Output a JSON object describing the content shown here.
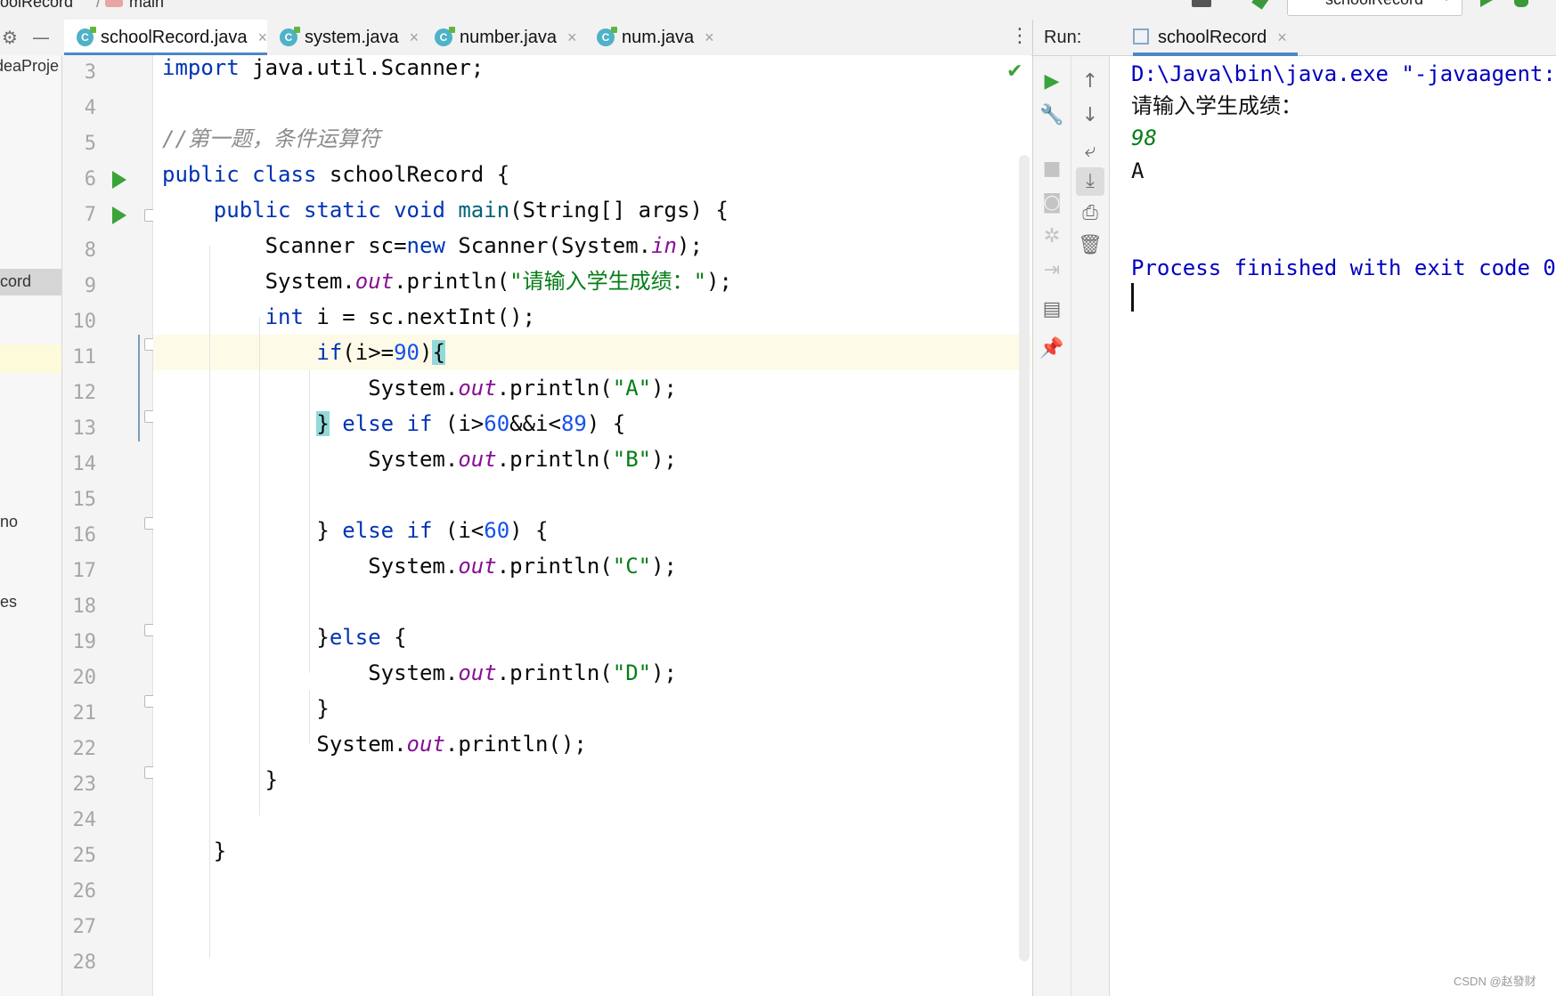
{
  "breadcrumb": {
    "file": "oolRecord",
    "separator": "/",
    "branch": "main"
  },
  "toolbar": {
    "run_config": "schoolRecord"
  },
  "editor_tabs": [
    {
      "label": "schoolRecord.java",
      "active": true
    },
    {
      "label": "system.java",
      "active": false
    },
    {
      "label": "number.java",
      "active": false
    },
    {
      "label": "num.java",
      "active": false
    }
  ],
  "project_panel": {
    "items": [
      "deaProje",
      "cord",
      "no",
      "es"
    ]
  },
  "code": {
    "line_numbers": [
      "3",
      "4",
      "5",
      "6",
      "7",
      "8",
      "9",
      "10",
      "11",
      "12",
      "13",
      "14",
      "15",
      "16",
      "17",
      "18",
      "19",
      "20",
      "21",
      "22",
      "23",
      "24",
      "25",
      "26",
      "27",
      "28"
    ],
    "l3": {
      "kw": "import",
      "rest": " java.util.Scanner;"
    },
    "l5": {
      "comment": "//第一题，条件运算符"
    },
    "l6": {
      "kw1": "public",
      "kw2": "class",
      "rest": " schoolRecord {"
    },
    "l7": {
      "kw1": "public",
      "kw2": "static",
      "kw3": "void",
      "fn": "main",
      "rest": "(String[] args) {"
    },
    "l8": {
      "a": "Scanner sc=",
      "kw": "new",
      "b": " Scanner(System.",
      "fld": "in",
      "c": ");"
    },
    "l9": {
      "a": "System.",
      "fld": "out",
      "b": ".println(",
      "str": "\"请输入学生成绩：\"",
      "c": ");"
    },
    "l10": {
      "kw": "int",
      "rest": " i = sc.nextInt();"
    },
    "l11": {
      "kw": "if",
      "a": "(i>=",
      "num": "90",
      "b": ")",
      "brace": "{"
    },
    "l12": {
      "a": "System.",
      "fld": "out",
      "b": ".println(",
      "str": "\"A\"",
      "c": ");"
    },
    "l13": {
      "brace": "}",
      "kw": "else if",
      "a": " (i>",
      "num1": "60",
      "b": "&&i<",
      "num2": "89",
      "c": ") {"
    },
    "l14": {
      "a": "System.",
      "fld": "out",
      "b": ".println(",
      "str": "\"B\"",
      "c": ");"
    },
    "l16": {
      "a": "} ",
      "kw": "else if",
      "b": " (i<",
      "num": "60",
      "c": ") {"
    },
    "l17": {
      "a": "System.",
      "fld": "out",
      "b": ".println(",
      "str": "\"C\"",
      "c": ");"
    },
    "l19": {
      "a": "}",
      "kw": "else",
      "b": " {"
    },
    "l20": {
      "a": "System.",
      "fld": "out",
      "b": ".println(",
      "str": "\"D\"",
      "c": ");"
    },
    "l21": {
      "text": "}"
    },
    "l22": {
      "a": "System.",
      "fld": "out",
      "b": ".println();"
    },
    "l23": {
      "text": "}"
    },
    "l25": {
      "text": "}"
    }
  },
  "run_panel": {
    "label": "Run:",
    "tab": "schoolRecord",
    "console": {
      "command": "D:\\Java\\bin\\java.exe \"-javaagent:D",
      "prompt": "请输入学生成绩：",
      "input": "98",
      "output": "A",
      "exit": "Process finished with exit code 0"
    }
  },
  "watermark": "CSDN @赵發财"
}
